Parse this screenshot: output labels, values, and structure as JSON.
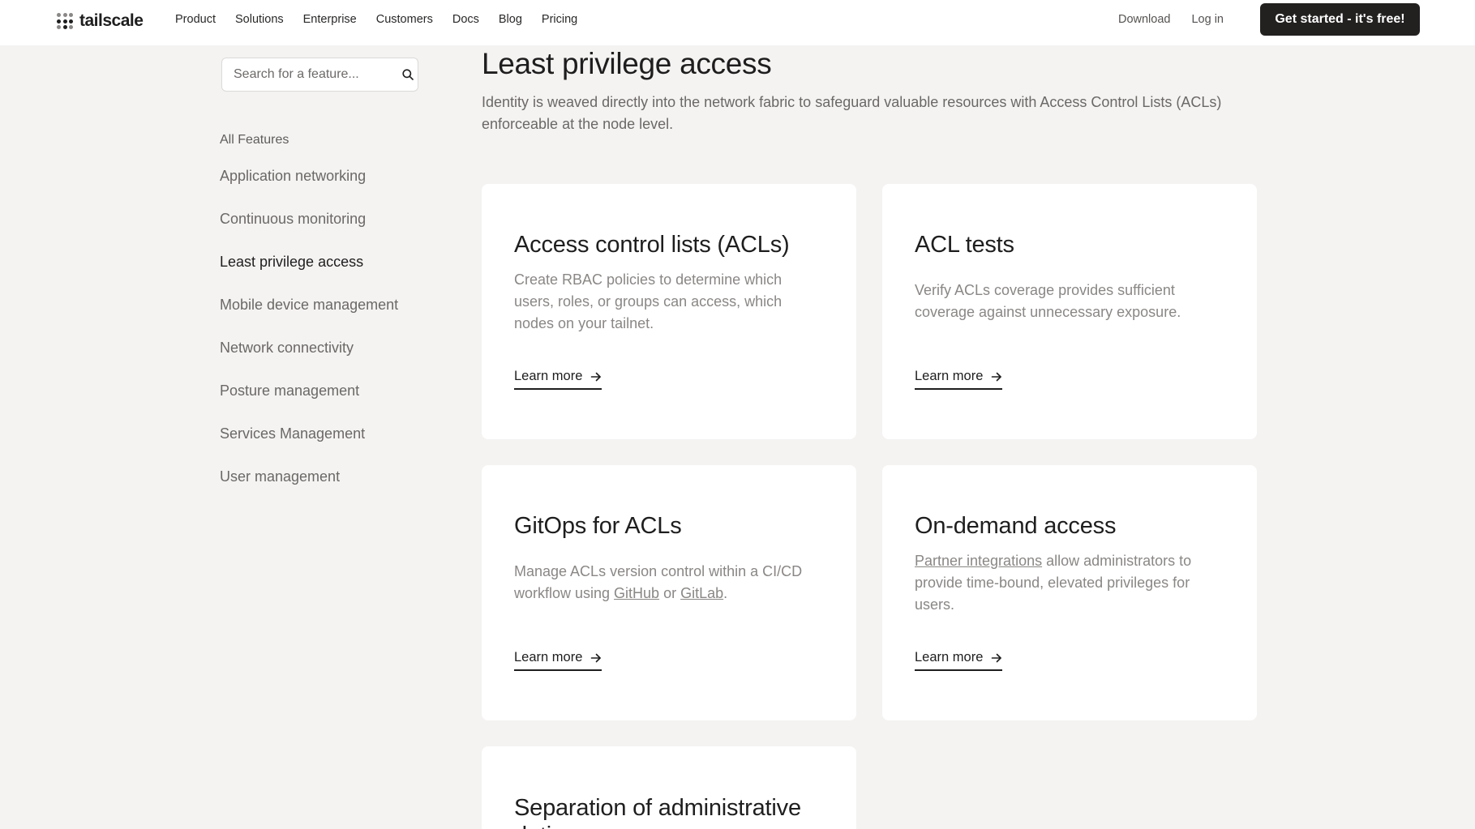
{
  "header": {
    "logo_text": "tailscale",
    "nav": [
      "Product",
      "Solutions",
      "Enterprise",
      "Customers",
      "Docs",
      "Blog",
      "Pricing"
    ],
    "download": "Download",
    "login": "Log in",
    "cta": "Get started - it's free!"
  },
  "sidebar": {
    "search_placeholder": "Search for a feature...",
    "all_features": "All Features",
    "items": [
      {
        "label": "Application networking"
      },
      {
        "label": "Continuous monitoring"
      },
      {
        "label": "Least privilege access"
      },
      {
        "label": "Mobile device management"
      },
      {
        "label": "Network connectivity"
      },
      {
        "label": "Posture management"
      },
      {
        "label": "Services Management"
      },
      {
        "label": "User management"
      }
    ],
    "active_index": 2
  },
  "main": {
    "title": "Least privilege access",
    "description": "Identity is weaved directly into the network fabric to safeguard valuable resources with Access Control Lists (ACLs) enforceable at the node level.",
    "learn_more": "Learn more",
    "cards": [
      {
        "title": "Access control lists (ACLs)",
        "description": "Create RBAC policies to determine which users, roles, or groups can access, which nodes on your tailnet."
      },
      {
        "title": "ACL tests",
        "description": "Verify ACLs coverage provides sufficient coverage against unnecessary exposure."
      },
      {
        "title": "GitOps for ACLs",
        "desc_pre": "Manage ACLs version control within a CI/CD workflow using ",
        "link1": "GitHub",
        "desc_mid": " or ",
        "link2": "GitLab",
        "desc_post": "."
      },
      {
        "title": "On-demand access",
        "link1": "Partner integrations",
        "desc_post": " allow administrators to provide time-bound, elevated privileges for users."
      },
      {
        "title": "Separation of administrative duties"
      }
    ]
  }
}
